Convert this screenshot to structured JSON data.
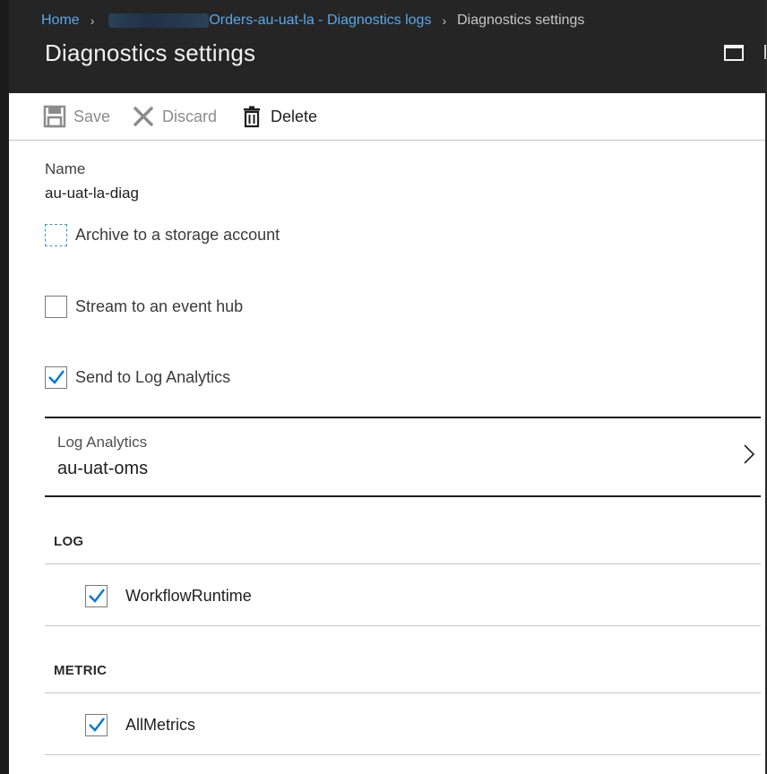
{
  "breadcrumb": {
    "home": "Home",
    "resource": "Orders-au-uat-la - Diagnostics logs",
    "current": "Diagnostics settings"
  },
  "blade": {
    "title": "Diagnostics settings"
  },
  "toolbar": {
    "save": "Save",
    "discard": "Discard",
    "delete": "Delete"
  },
  "form": {
    "name_label": "Name",
    "name_value": "au-uat-la-diag",
    "archive_label": "Archive to a storage account",
    "archive_checked": false,
    "stream_label": "Stream to an event hub",
    "stream_checked": false,
    "loganalytics_label": "Send to Log Analytics",
    "loganalytics_checked": true
  },
  "log_analytics": {
    "label": "Log Analytics",
    "value": "au-uat-oms"
  },
  "log_section": {
    "heading": "LOG",
    "items": [
      {
        "label": "WorkflowRuntime",
        "checked": true
      }
    ]
  },
  "metric_section": {
    "heading": "METRIC",
    "items": [
      {
        "label": "AllMetrics",
        "checked": true
      }
    ]
  },
  "colors": {
    "header_bg": "#252525",
    "link": "#5ba8e8",
    "check_accent": "#0078d4",
    "focus_border": "#2b9bd6"
  }
}
